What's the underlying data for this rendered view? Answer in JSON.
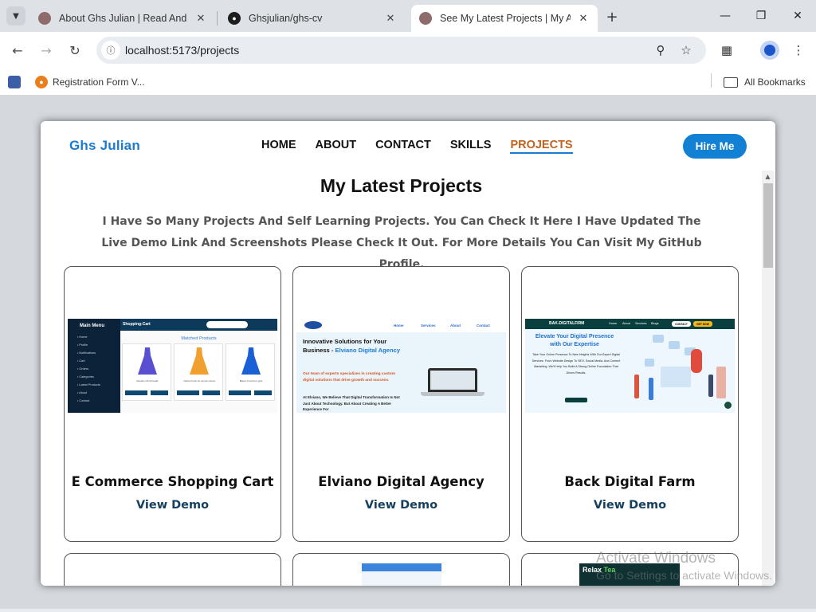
{
  "browser": {
    "tabs": [
      {
        "title": "About Ghs Julian | Read And Kn",
        "active": false
      },
      {
        "title": "Ghsjulian/ghs-cv",
        "active": false
      },
      {
        "title": "See My Latest Projects | My All I",
        "active": true
      }
    ],
    "new_tab_symbol": "+",
    "url": "localhost:5173/projects",
    "bookmarks": [
      {
        "label": ""
      },
      {
        "label": "Registration Form V..."
      }
    ],
    "all_bookmarks_label": "All Bookmarks"
  },
  "site": {
    "logo": "Ghs Julian",
    "nav": [
      {
        "label": "HOME",
        "active": false
      },
      {
        "label": "ABOUT",
        "active": false
      },
      {
        "label": "CONTACT",
        "active": false
      },
      {
        "label": "SKILLS",
        "active": false
      },
      {
        "label": "PROJECTS",
        "active": true
      }
    ],
    "hire_label": "Hire Me",
    "section_title": "My Latest Projects",
    "section_desc": "I Have So Many Projects And Self Learning Projects. You Can Check It Here I Have Updated The Live Demo Link And Screenshots Please Check It Out. For More Details You Can Visit My GitHub Profile.",
    "projects": [
      {
        "title": "E Commerce Shopping Cart",
        "link_label": "View Demo"
      },
      {
        "title": "Elviano Digital Agency",
        "link_label": "View Demo"
      },
      {
        "title": "Back Digital Farm",
        "link_label": "View Demo"
      }
    ],
    "thumb_texts": {
      "cart_menu": "Main Menu",
      "cart_brand": "Shopping-Cart",
      "cart_matched": "Matched Products",
      "agency_headline": "Innovative Solutions for Your Business -",
      "agency_headline_blue": "Elviano Digital Agency",
      "agency_para": "Our team of experts specializes in creating custom digital solutions that drive growth and success.",
      "agency_para2": "At Elviano, We Believe That Digital Transformation Is Not Just About Technology. But About Creating A Better Experience For",
      "farm_headline": "Elevate Your Digital Presence with Our Expertise",
      "farm_logo": "BAK-DIGITALFIRM",
      "tea_label_1": "Relax",
      "tea_label_2": "Tea"
    }
  },
  "watermark": {
    "line1": "Activate Windows",
    "line2": "Go to Settings to activate Windows."
  },
  "colors": {
    "brand_blue": "#1b7bd0",
    "active_nav": "#c0621d",
    "hire_button": "#1281d3",
    "link_color": "#143f5e"
  }
}
